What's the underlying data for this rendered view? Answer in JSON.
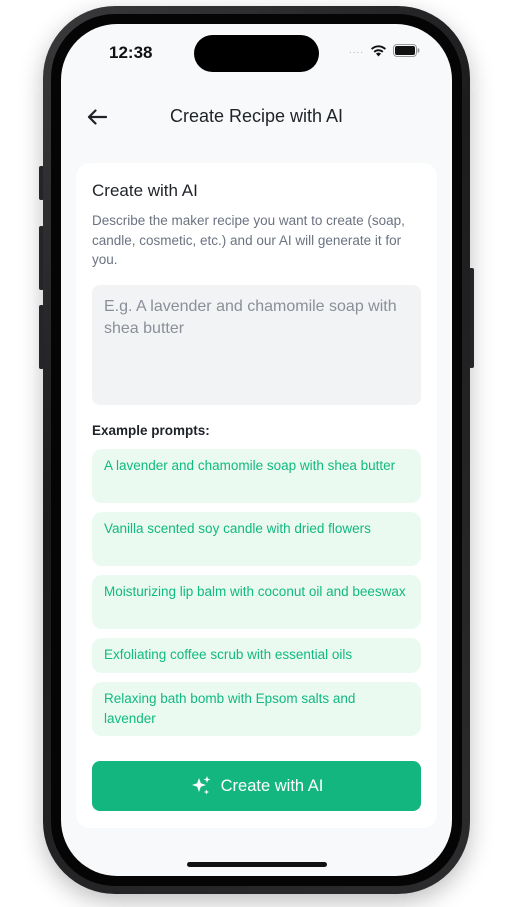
{
  "status_bar": {
    "time": "12:38",
    "signal_dots": "....",
    "icons": [
      "wifi-icon",
      "battery-icon"
    ]
  },
  "header": {
    "back_icon": "arrow-left-icon",
    "title": "Create Recipe with AI"
  },
  "card": {
    "title": "Create with AI",
    "description": "Describe the maker recipe you want to create (soap, candle, cosmetic, etc.) and our AI will generate it for you.",
    "prompt_input": {
      "value": "",
      "placeholder": "E.g. A lavender and chamomile soap with shea butter"
    },
    "examples_heading": "Example prompts:",
    "examples": [
      "A lavender and chamomile soap with shea butter",
      "Vanilla scented soy candle with dried flowers",
      "Moisturizing lip balm with coconut oil and beeswax",
      "Exfoliating coffee scrub with essential oils",
      "Relaxing bath bomb with Epsom salts and lavender"
    ],
    "create_button": {
      "icon": "sparkles-icon",
      "label": "Create with AI"
    }
  },
  "colors": {
    "accent": "#13b67f",
    "chip_background": "#ebfaf1",
    "chip_text": "#10b981",
    "screen_background": "#f8f9fa"
  }
}
